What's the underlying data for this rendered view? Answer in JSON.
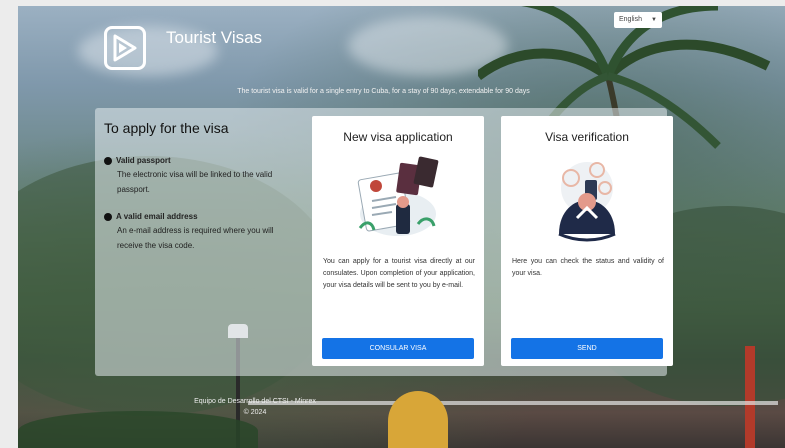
{
  "header": {
    "title": "Tourist Visas",
    "language": "English",
    "subtitle": "The tourist visa is valid for a single entry to Cuba, for a stay of 90 days, extendable for 90 days"
  },
  "apply": {
    "title": "To apply for the visa",
    "requirements": [
      {
        "head": "Valid passport",
        "desc": "The electronic visa will be linked to the valid passport."
      },
      {
        "head": "A valid email address",
        "desc": "An e-mail address is required where you will receive the visa code."
      }
    ]
  },
  "cards": [
    {
      "title": "New visa application",
      "desc": "You can apply for a tourist visa directly at our consulates. Upon completion of your application, your visa details will be sent to you by e-mail.",
      "button": "CONSULAR VISA",
      "icon": "passport-application-icon"
    },
    {
      "title": "Visa verification",
      "desc": "Here you can check the status and validity of your visa.",
      "button": "SEND",
      "icon": "person-verifying-icon"
    }
  ],
  "footer": {
    "left_line1": "Equipo de Desarrollo del CTSI - Minrex",
    "left_line2": "© 2024"
  },
  "colors": {
    "accent": "#1473e6"
  }
}
